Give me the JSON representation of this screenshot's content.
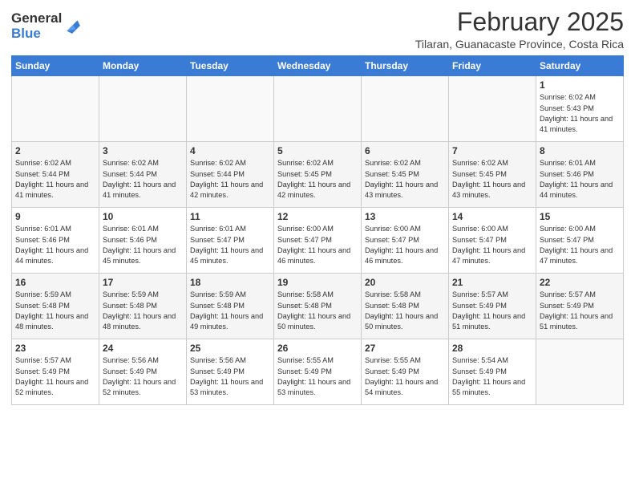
{
  "header": {
    "logo_general": "General",
    "logo_blue": "Blue",
    "month": "February 2025",
    "location": "Tilaran, Guanacaste Province, Costa Rica"
  },
  "weekdays": [
    "Sunday",
    "Monday",
    "Tuesday",
    "Wednesday",
    "Thursday",
    "Friday",
    "Saturday"
  ],
  "weeks": [
    [
      {
        "day": "",
        "info": ""
      },
      {
        "day": "",
        "info": ""
      },
      {
        "day": "",
        "info": ""
      },
      {
        "day": "",
        "info": ""
      },
      {
        "day": "",
        "info": ""
      },
      {
        "day": "",
        "info": ""
      },
      {
        "day": "1",
        "info": "Sunrise: 6:02 AM\nSunset: 5:43 PM\nDaylight: 11 hours\nand 41 minutes."
      }
    ],
    [
      {
        "day": "2",
        "info": "Sunrise: 6:02 AM\nSunset: 5:44 PM\nDaylight: 11 hours\nand 41 minutes."
      },
      {
        "day": "3",
        "info": "Sunrise: 6:02 AM\nSunset: 5:44 PM\nDaylight: 11 hours\nand 41 minutes."
      },
      {
        "day": "4",
        "info": "Sunrise: 6:02 AM\nSunset: 5:44 PM\nDaylight: 11 hours\nand 42 minutes."
      },
      {
        "day": "5",
        "info": "Sunrise: 6:02 AM\nSunset: 5:45 PM\nDaylight: 11 hours\nand 42 minutes."
      },
      {
        "day": "6",
        "info": "Sunrise: 6:02 AM\nSunset: 5:45 PM\nDaylight: 11 hours\nand 43 minutes."
      },
      {
        "day": "7",
        "info": "Sunrise: 6:02 AM\nSunset: 5:45 PM\nDaylight: 11 hours\nand 43 minutes."
      },
      {
        "day": "8",
        "info": "Sunrise: 6:01 AM\nSunset: 5:46 PM\nDaylight: 11 hours\nand 44 minutes."
      }
    ],
    [
      {
        "day": "9",
        "info": "Sunrise: 6:01 AM\nSunset: 5:46 PM\nDaylight: 11 hours\nand 44 minutes."
      },
      {
        "day": "10",
        "info": "Sunrise: 6:01 AM\nSunset: 5:46 PM\nDaylight: 11 hours\nand 45 minutes."
      },
      {
        "day": "11",
        "info": "Sunrise: 6:01 AM\nSunset: 5:47 PM\nDaylight: 11 hours\nand 45 minutes."
      },
      {
        "day": "12",
        "info": "Sunrise: 6:00 AM\nSunset: 5:47 PM\nDaylight: 11 hours\nand 46 minutes."
      },
      {
        "day": "13",
        "info": "Sunrise: 6:00 AM\nSunset: 5:47 PM\nDaylight: 11 hours\nand 46 minutes."
      },
      {
        "day": "14",
        "info": "Sunrise: 6:00 AM\nSunset: 5:47 PM\nDaylight: 11 hours\nand 47 minutes."
      },
      {
        "day": "15",
        "info": "Sunrise: 6:00 AM\nSunset: 5:47 PM\nDaylight: 11 hours\nand 47 minutes."
      }
    ],
    [
      {
        "day": "16",
        "info": "Sunrise: 5:59 AM\nSunset: 5:48 PM\nDaylight: 11 hours\nand 48 minutes."
      },
      {
        "day": "17",
        "info": "Sunrise: 5:59 AM\nSunset: 5:48 PM\nDaylight: 11 hours\nand 48 minutes."
      },
      {
        "day": "18",
        "info": "Sunrise: 5:59 AM\nSunset: 5:48 PM\nDaylight: 11 hours\nand 49 minutes."
      },
      {
        "day": "19",
        "info": "Sunrise: 5:58 AM\nSunset: 5:48 PM\nDaylight: 11 hours\nand 50 minutes."
      },
      {
        "day": "20",
        "info": "Sunrise: 5:58 AM\nSunset: 5:48 PM\nDaylight: 11 hours\nand 50 minutes."
      },
      {
        "day": "21",
        "info": "Sunrise: 5:57 AM\nSunset: 5:49 PM\nDaylight: 11 hours\nand 51 minutes."
      },
      {
        "day": "22",
        "info": "Sunrise: 5:57 AM\nSunset: 5:49 PM\nDaylight: 11 hours\nand 51 minutes."
      }
    ],
    [
      {
        "day": "23",
        "info": "Sunrise: 5:57 AM\nSunset: 5:49 PM\nDaylight: 11 hours\nand 52 minutes."
      },
      {
        "day": "24",
        "info": "Sunrise: 5:56 AM\nSunset: 5:49 PM\nDaylight: 11 hours\nand 52 minutes."
      },
      {
        "day": "25",
        "info": "Sunrise: 5:56 AM\nSunset: 5:49 PM\nDaylight: 11 hours\nand 53 minutes."
      },
      {
        "day": "26",
        "info": "Sunrise: 5:55 AM\nSunset: 5:49 PM\nDaylight: 11 hours\nand 53 minutes."
      },
      {
        "day": "27",
        "info": "Sunrise: 5:55 AM\nSunset: 5:49 PM\nDaylight: 11 hours\nand 54 minutes."
      },
      {
        "day": "28",
        "info": "Sunrise: 5:54 AM\nSunset: 5:49 PM\nDaylight: 11 hours\nand 55 minutes."
      },
      {
        "day": "",
        "info": ""
      }
    ]
  ]
}
